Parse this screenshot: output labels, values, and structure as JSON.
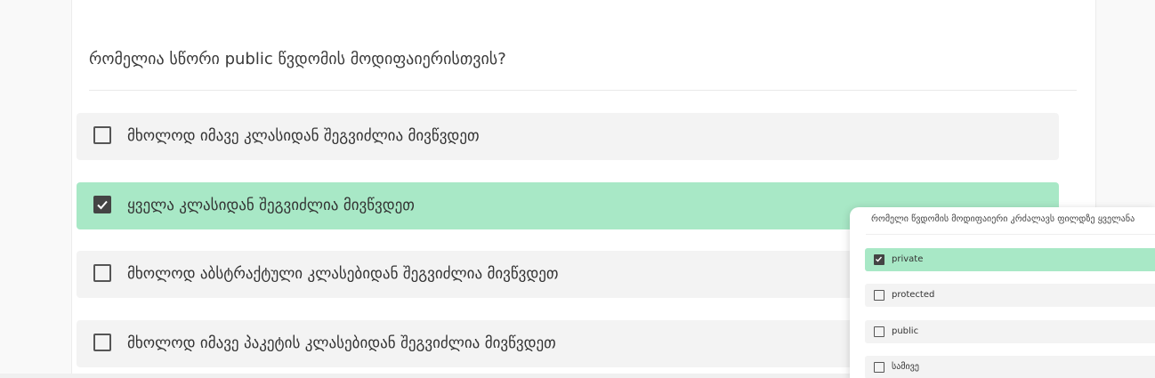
{
  "question": "რომელია სწორი public წვდომის მოდიფაიერისთვის?",
  "options": [
    {
      "label": "მხოლოდ იმავე კლასიდან შეგვიძლია მივწვდეთ",
      "checked": false
    },
    {
      "label": "ყველა კლასიდან შეგვიძლია მივწვდეთ",
      "checked": true
    },
    {
      "label": "მხოლოდ აბსტრაქტული კლასებიდან შეგვიძლია მივწვდეთ",
      "checked": false
    },
    {
      "label": "მხოლოდ იმავე პაკეტის კლასებიდან შეგვიძლია მივწვდეთ",
      "checked": false
    }
  ],
  "popup": {
    "question": "რომელი წვდომის მოდიფაიერი კრძალავს ფილდზე ყველანა",
    "options": [
      {
        "label": "private",
        "checked": true
      },
      {
        "label": "protected",
        "checked": false
      },
      {
        "label": "public",
        "checked": false
      },
      {
        "label": "სამივე",
        "checked": false
      }
    ]
  },
  "colors": {
    "checked_bg": "#a8e8c6",
    "option_bg": "#f3f3f3",
    "checkbox": "#444444"
  }
}
